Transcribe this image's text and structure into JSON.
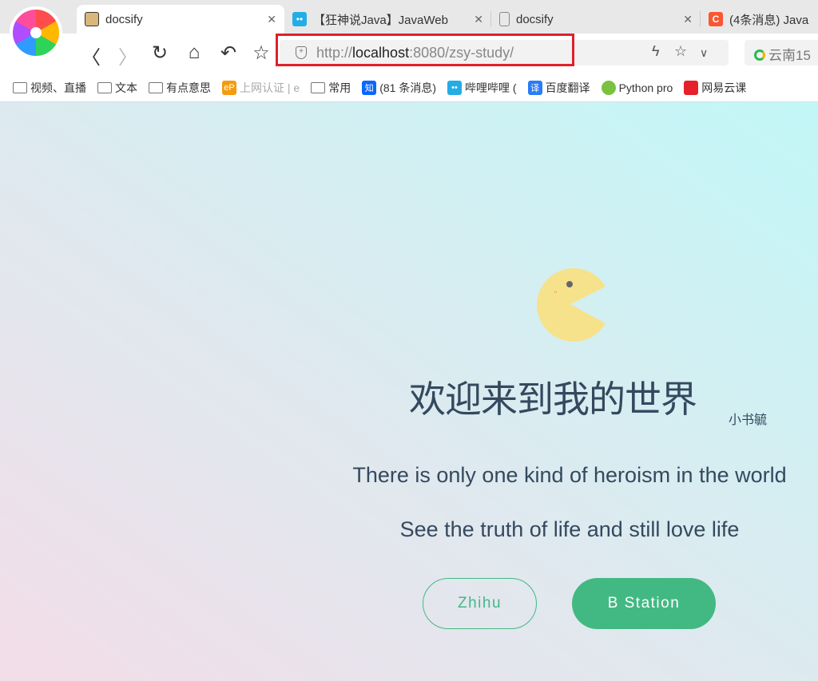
{
  "browser": {
    "tabs": [
      {
        "title": "docsify",
        "active": true
      },
      {
        "title": "【狂神说Java】JavaWeb"
      },
      {
        "title": "docsify"
      },
      {
        "title": "(4条消息) Java"
      }
    ],
    "address": {
      "scheme": "http://",
      "host": "localhost",
      "rest": ":8080/zsy-study/"
    },
    "search_text": "云南15",
    "bookmarks": [
      "视频、直播",
      "文本",
      "有点意思",
      "上网认证 | e",
      "常用",
      "(81 条消息)",
      "哔哩哔哩 (",
      "百度翻译",
      "Python pro",
      "网易云课"
    ],
    "bookmark_icons": {
      "ep": "eP",
      "zhi": "知",
      "yi": "译"
    }
  },
  "page": {
    "title": "欢迎来到我的世界",
    "subtitle": "小书毓",
    "line1": "There is only one kind of heroism in the world",
    "line2": "See the truth of life and still love life",
    "button1": "Zhihu",
    "button2": "B Station"
  },
  "colors": {
    "accent": "#42b983",
    "text": "#34495e",
    "highlight": "#e0202a"
  }
}
